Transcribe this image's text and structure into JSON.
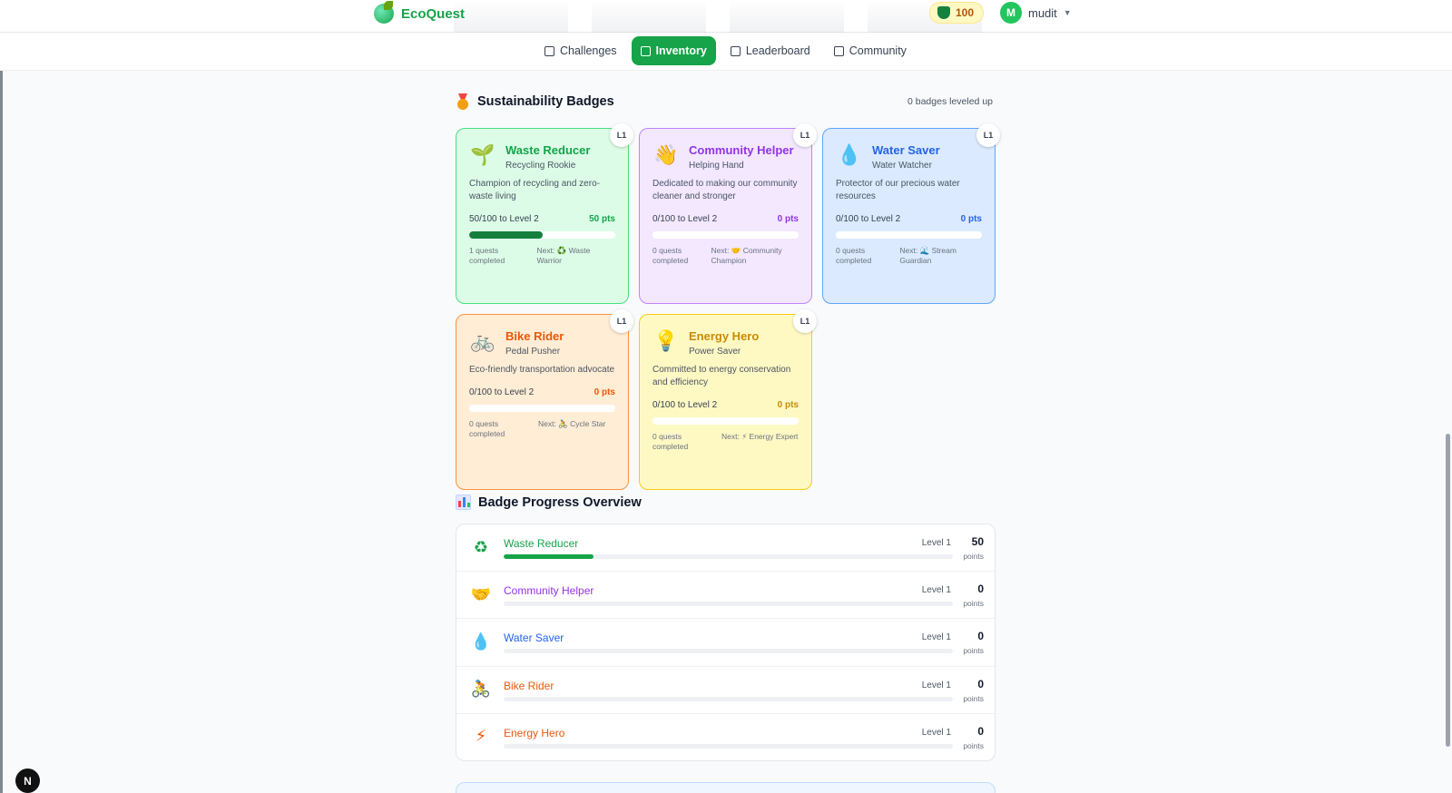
{
  "header": {
    "app_name": "EcoQuest",
    "points": "100",
    "user_initial": "M",
    "username": "mudit"
  },
  "nav": {
    "tabs": [
      {
        "label": "Challenges",
        "icon": "map-icon",
        "active": false
      },
      {
        "label": "Inventory",
        "icon": "bag-icon",
        "active": true
      },
      {
        "label": "Leaderboard",
        "icon": "bar-chart-icon",
        "active": false
      },
      {
        "label": "Community",
        "icon": "people-icon",
        "active": false
      }
    ]
  },
  "badges_section": {
    "title": "Sustainability Badges",
    "leveled_up": "0 badges leveled up",
    "cards": [
      {
        "name": "Waste Reducer",
        "subtitle": "Recycling Rookie",
        "description": "Champion of recycling and zero-waste living",
        "progress_text": "50/100 to Level 2",
        "pts": "50 pts",
        "progress": 0.5,
        "quests": "1 quests completed",
        "next": "Next: ♻️ Waste Warrior",
        "level": "L1",
        "emoji": "🌱",
        "accent": "#16a34a",
        "bg": "#dcfce7",
        "border": "#4ade80",
        "bar": "#15803d"
      },
      {
        "name": "Community Helper",
        "subtitle": "Helping Hand",
        "description": "Dedicated to making our community cleaner and stronger",
        "progress_text": "0/100 to Level 2",
        "pts": "0 pts",
        "progress": 0,
        "quests": "0 quests completed",
        "next": "Next: 🤝 Community Champion",
        "level": "L1",
        "emoji": "👋",
        "accent": "#9333ea",
        "bg": "#f3e8ff",
        "border": "#c084fc",
        "bar": "#9333ea"
      },
      {
        "name": "Water Saver",
        "subtitle": "Water Watcher",
        "description": "Protector of our precious water resources",
        "progress_text": "0/100 to Level 2",
        "pts": "0 pts",
        "progress": 0,
        "quests": "0 quests completed",
        "next": "Next: 🌊 Stream Guardian",
        "level": "L1",
        "emoji": "💧",
        "accent": "#2563eb",
        "bg": "#dbeafe",
        "border": "#60a5fa",
        "bar": "#2563eb"
      },
      {
        "name": "Bike Rider",
        "subtitle": "Pedal Pusher",
        "description": "Eco-friendly transportation advocate",
        "progress_text": "0/100 to Level 2",
        "pts": "0 pts",
        "progress": 0,
        "quests": "0 quests completed",
        "next": "Next: 🚴 Cycle Star",
        "level": "L1",
        "emoji": "🚲",
        "accent": "#ea580c",
        "bg": "#ffedd5",
        "border": "#fb923c",
        "bar": "#ea580c"
      },
      {
        "name": "Energy Hero",
        "subtitle": "Power Saver",
        "description": "Committed to energy conservation and efficiency",
        "progress_text": "0/100 to Level 2",
        "pts": "0 pts",
        "progress": 0,
        "quests": "0 quests completed",
        "next": "Next: ⚡ Energy Expert",
        "level": "L1",
        "emoji": "💡",
        "accent": "#ca8a04",
        "bg": "#fef9c3",
        "border": "#facc15",
        "bar": "#ca8a04"
      }
    ]
  },
  "overview_section": {
    "title": "Badge Progress Overview",
    "rows": [
      {
        "name": "Waste Reducer",
        "level": "Level 1",
        "points": "50",
        "unit": "points",
        "progress": 0.2,
        "emoji": "♻",
        "color": "#16a34a"
      },
      {
        "name": "Community Helper",
        "level": "Level 1",
        "points": "0",
        "unit": "points",
        "progress": 0,
        "emoji": "🤝",
        "color": "#9333ea"
      },
      {
        "name": "Water Saver",
        "level": "Level 1",
        "points": "0",
        "unit": "points",
        "progress": 0,
        "emoji": "💧",
        "color": "#2563eb"
      },
      {
        "name": "Bike Rider",
        "level": "Level 1",
        "points": "0",
        "unit": "points",
        "progress": 0,
        "emoji": "🚴",
        "color": "#ea580c"
      },
      {
        "name": "Energy Hero",
        "level": "Level 1",
        "points": "0",
        "unit": "points",
        "progress": 0,
        "emoji": "⚡",
        "color": "#ea580c"
      }
    ]
  },
  "dev_badge": "N"
}
